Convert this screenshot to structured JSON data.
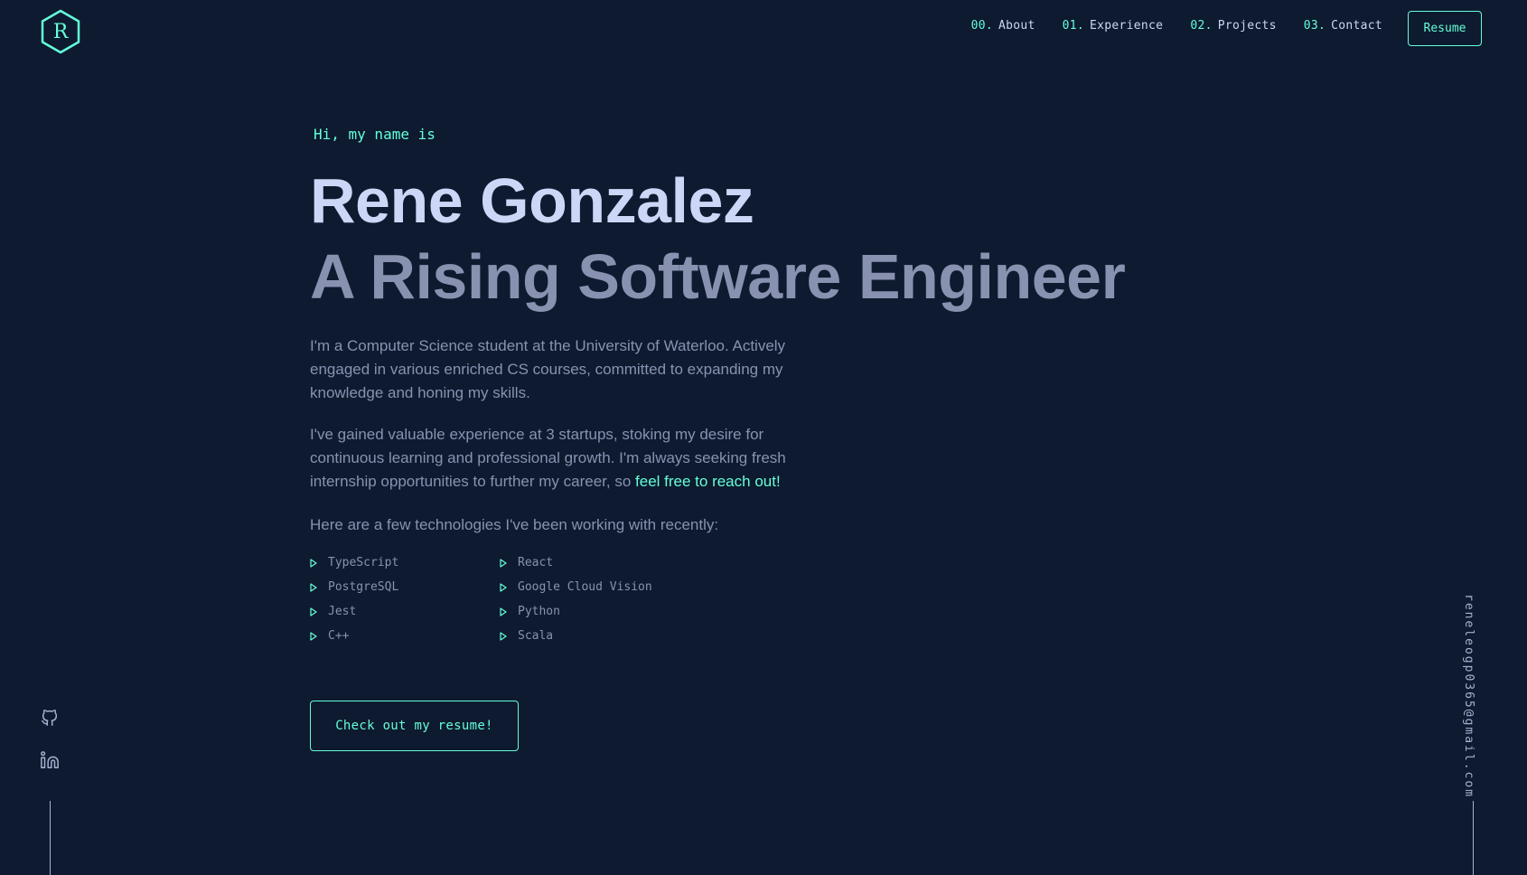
{
  "brand": {
    "logo_letter": "R"
  },
  "nav": {
    "items": [
      {
        "num": "00.",
        "label": "About"
      },
      {
        "num": "01.",
        "label": "Experience"
      },
      {
        "num": "02.",
        "label": "Projects"
      },
      {
        "num": "03.",
        "label": "Contact"
      }
    ],
    "resume_label": "Resume"
  },
  "hero": {
    "greeting": "Hi, my name is",
    "name": "Rene Gonzalez",
    "tagline": "A Rising Software Engineer",
    "paragraph1": "I'm a Computer Science student at the University of Waterloo. Actively engaged in various enriched CS courses, committed to expanding my knowledge and honing my skills.",
    "paragraph2_text": "I've gained valuable experience at 3 startups, stoking my desire for continuous learning and professional growth. I'm always seeking fresh internship opportunities to further my career, so ",
    "paragraph2_link": "feel free to reach out!",
    "tech_intro": "Here are a few technologies I've been working with recently:",
    "technologies": [
      "TypeScript",
      "React",
      "PostgreSQL",
      "Google Cloud Vision",
      "Jest",
      "Python",
      "C++",
      "Scala"
    ],
    "cta_label": "Check out my resume!"
  },
  "sidebar": {
    "icons": [
      "github-icon",
      "linkedin-icon"
    ],
    "email": "reneleogp0365@gmail.com"
  },
  "colors": {
    "background": "#0e1a2f",
    "accent": "#64ffda",
    "heading": "#ccd6f6",
    "body_text": "#8892b0"
  }
}
